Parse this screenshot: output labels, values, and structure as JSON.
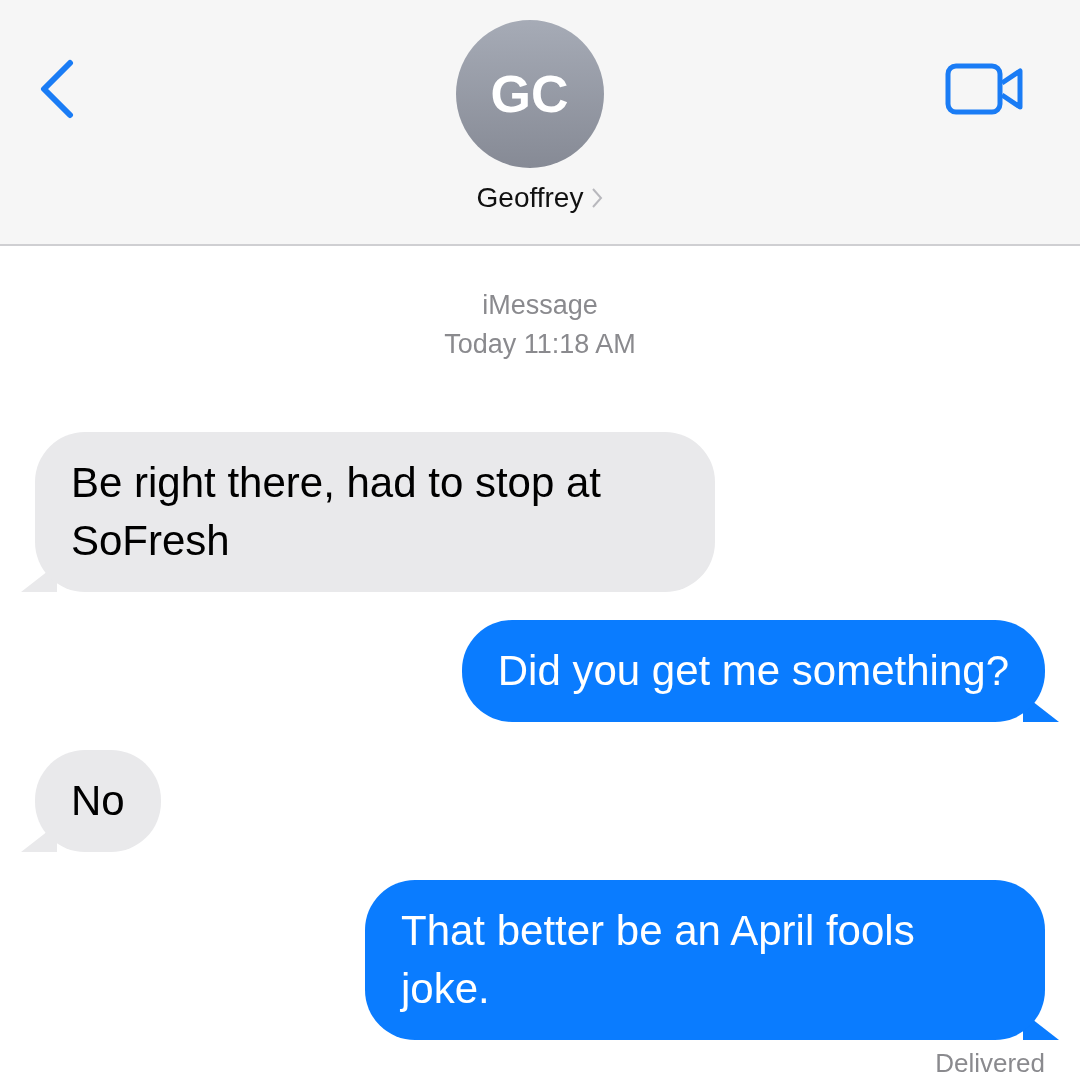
{
  "header": {
    "avatar_initials": "GC",
    "contact_name": "Geoffrey"
  },
  "conversation": {
    "service": "iMessage",
    "timestamp": "Today 11:18 AM"
  },
  "messages": [
    {
      "kind": "incoming",
      "text": "Be right there, had to stop at SoFresh"
    },
    {
      "kind": "outgoing",
      "text": "Did you get me something?"
    },
    {
      "kind": "incoming",
      "text": "No"
    },
    {
      "kind": "outgoing",
      "text": "That better be an April fools joke."
    }
  ],
  "status": "Delivered"
}
